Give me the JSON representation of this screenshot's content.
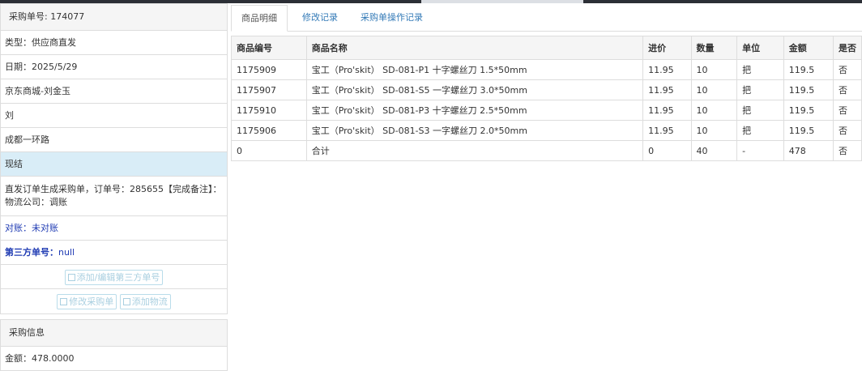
{
  "order_panel": {
    "title": "采购单号: 174077",
    "type": "类型：供应商直发",
    "date": "日期：2025/5/29",
    "supplier": "京东商城-刘金玉",
    "contact": "刘",
    "address": "成都一环路",
    "settlement": "现结",
    "remark": "直发订单生成采购单，订单号：285655【完成备注】： 物流公司：调账",
    "reconcile": "对账：未对账",
    "third_party_label": "第三方单号：",
    "third_party_value": "null",
    "btn_third_party": "添加/编辑第三方单号",
    "btn_edit_order": "修改采购单",
    "btn_add_logistics": "添加物流"
  },
  "purchase_panel": {
    "title": "采购信息",
    "amount": "金额：478.0000"
  },
  "tabs": [
    {
      "label": "商品明细"
    },
    {
      "label": "修改记录"
    },
    {
      "label": "采购单操作记录"
    }
  ],
  "table": {
    "columns": [
      "商品编号",
      "商品名称",
      "进价",
      "数量",
      "单位",
      "金额",
      "是否"
    ],
    "rows": [
      [
        "1175909",
        "宝工（Pro'skit） SD-081-P1 十字螺丝刀 1.5*50mm",
        "11.95",
        "10",
        "把",
        "119.5",
        "否"
      ],
      [
        "1175907",
        "宝工（Pro'skit） SD-081-S5 一字螺丝刀 3.0*50mm",
        "11.95",
        "10",
        "把",
        "119.5",
        "否"
      ],
      [
        "1175910",
        "宝工（Pro'skit） SD-081-P3 十字螺丝刀 2.5*50mm",
        "11.95",
        "10",
        "把",
        "119.5",
        "否"
      ],
      [
        "1175906",
        "宝工（Pro'skit） SD-081-S3 一字螺丝刀 2.0*50mm",
        "11.95",
        "10",
        "把",
        "119.5",
        "否"
      ],
      [
        "0",
        "合计",
        "0",
        "40",
        "-",
        "478",
        "否"
      ]
    ]
  }
}
